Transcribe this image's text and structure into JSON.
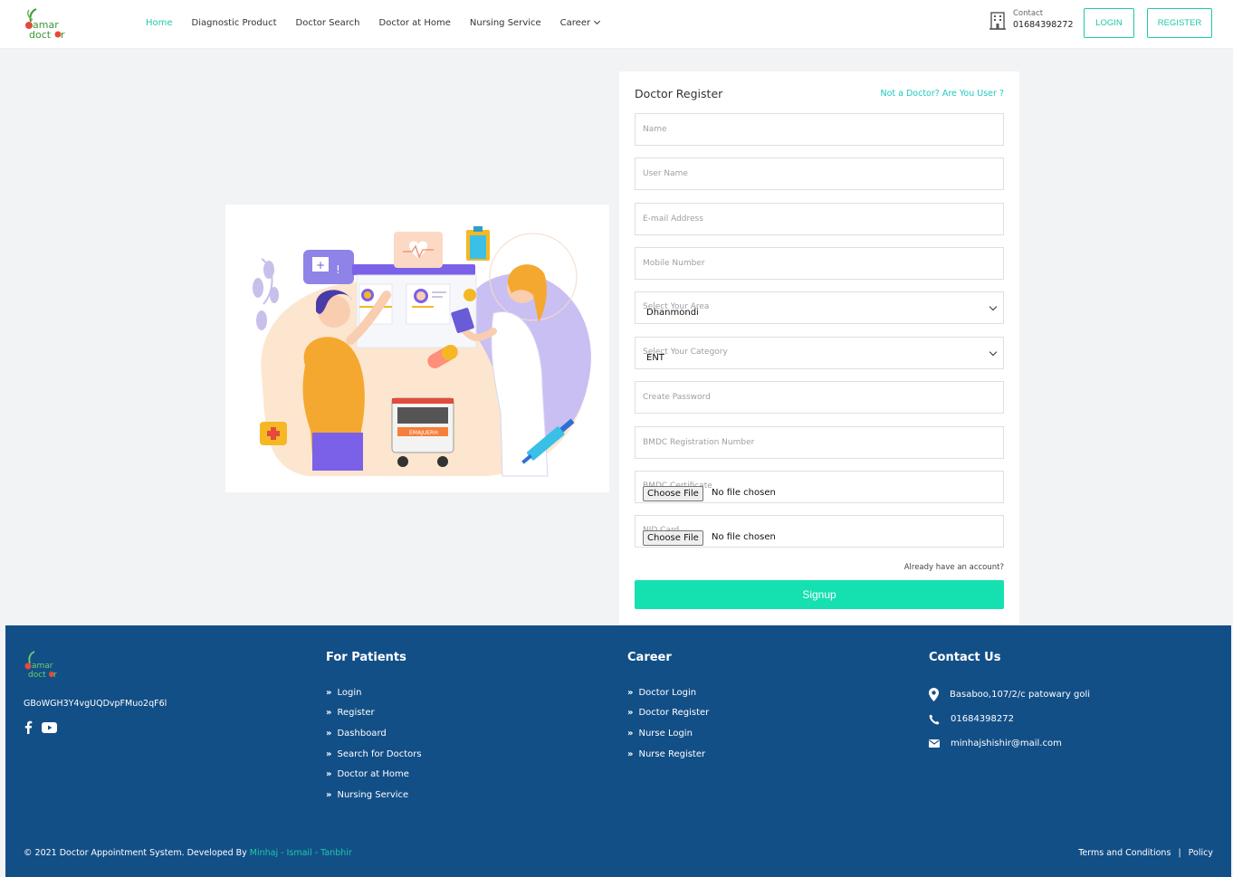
{
  "header": {
    "logo_text": "amar doctor",
    "nav": [
      {
        "label": "Home",
        "active": true
      },
      {
        "label": "Diagnostic Product",
        "active": false
      },
      {
        "label": "Doctor Search",
        "active": false
      },
      {
        "label": "Doctor at Home",
        "active": false
      },
      {
        "label": "Nursing Service",
        "active": false
      },
      {
        "label": "Career",
        "active": false,
        "has_dropdown": true
      }
    ],
    "contact_label": "Contact",
    "contact_phone": "01684398272",
    "login_label": "LOGIN",
    "register_label": "REGISTER",
    "accent_color": "#1ec9a8"
  },
  "form": {
    "title": "Doctor Register",
    "switch_link": "Not a Doctor? Are You User ?",
    "fields": {
      "name": "Name",
      "username": "User Name",
      "email": "E-mail Address",
      "mobile": "Mobile Number",
      "area_placeholder": "Select Your Area",
      "area_value": "Dhanmondi",
      "category_placeholder": "Select Your Category",
      "category_value": "ENT",
      "password": "Create Password",
      "bmdc_number": "BMDC Registration Number",
      "bmdc_cert_label": "BMDC Certificate",
      "nid_label": "NID Card",
      "choose_file": "Choose File",
      "no_file": "No file chosen"
    },
    "already_account": "Already have an account?",
    "signup_label": "Signup",
    "signup_color": "#15e0b0"
  },
  "illustration": {
    "ambulance_text": "EMAJUERH"
  },
  "footer": {
    "bg_color": "#134f87",
    "code": "GBoWGH3Y4vgUQDvpFMuo2qF6l",
    "patients_title": "For Patients",
    "patients_links": [
      "Login",
      "Register",
      "Dashboard",
      "Search for Doctors",
      "Doctor at Home",
      "Nursing Service"
    ],
    "career_title": "Career",
    "career_links": [
      "Doctor Login",
      "Doctor Register",
      "Nurse Login",
      "Nurse Register"
    ],
    "contact_title": "Contact Us",
    "contact_address": "Basaboo,107/2/c patowary goli",
    "contact_phone": "01684398272",
    "contact_email": "minhajshishir@mail.com",
    "copyright_prefix": "© 2021 Doctor Appointment System. Developed By ",
    "dev_1": "Minhaj",
    "dev_sep_1": " - ",
    "dev_2": "Ismail",
    "dev_sep_2": " - ",
    "dev_3": "Tanbhir",
    "terms": "Terms and Conditions",
    "divider": "|",
    "policy": "Policy"
  }
}
